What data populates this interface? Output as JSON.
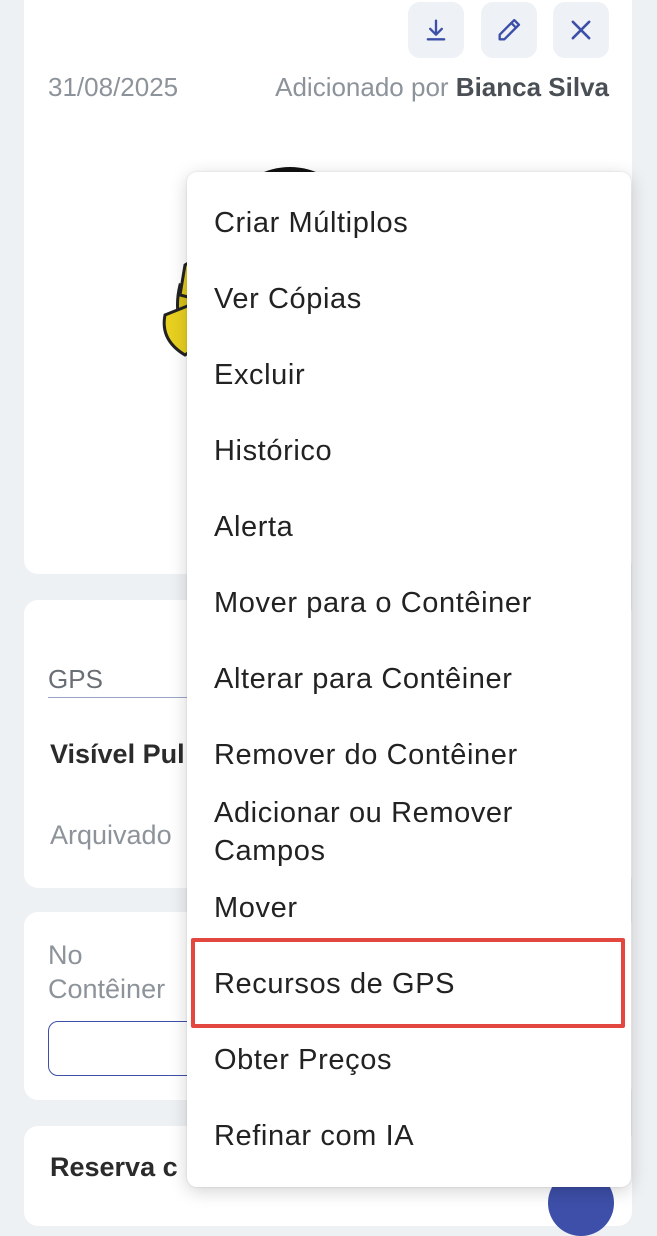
{
  "header": {
    "date": "31/08/2025",
    "added_by_prefix": "Adicionado por ",
    "added_by_name": "Bianca Silva",
    "icons": [
      "download-icon",
      "pencil-icon",
      "close-icon"
    ]
  },
  "details": {
    "gps_label": "GPS",
    "visible_public": "Visível Pul",
    "archived": "Arquivado",
    "in_container_line1": "No",
    "in_container_line2": "Contêiner",
    "reserva": "Reserva c"
  },
  "menu": {
    "items": [
      "Criar Múltiplos",
      "Ver Cópias",
      "Excluir",
      "Histórico",
      "Alerta",
      "Mover para o Contêiner",
      "Alterar para Contêiner",
      "Remover do Contêiner",
      "Adicionar ou Remover Campos",
      "Mover",
      "Recursos de GPS",
      "Obter Preços",
      "Refinar com IA"
    ],
    "highlighted_item": "Recursos de GPS"
  },
  "colors": {
    "accent": "#3d4fa8",
    "highlight": "#e2483f",
    "background": "#eef1f4"
  }
}
